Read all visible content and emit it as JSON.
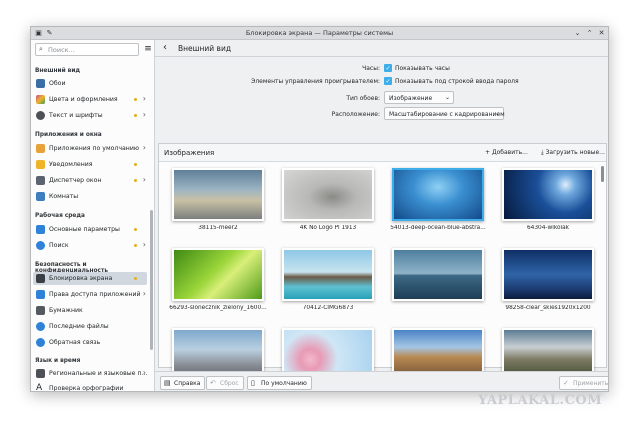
{
  "window": {
    "title": "Блокировка экрана — Параметры системы"
  },
  "sidebar": {
    "search_placeholder": "Поиск...",
    "sections": [
      {
        "title": "Внешний вид"
      },
      {
        "title": "Приложения и окна"
      },
      {
        "title": "Рабочая среда"
      },
      {
        "title": "Безопасность и конфиденциальность"
      },
      {
        "title": "Язык и время"
      }
    ],
    "items": [
      {
        "label": "Обои",
        "color": "#3a6ea5"
      },
      {
        "label": "Цвета и оформления",
        "color": "#c9508f"
      },
      {
        "label": "Текст и шрифты",
        "color": "#4d5157"
      },
      {
        "label": "Приложения по умолчанию",
        "color": "#e9a23b"
      },
      {
        "label": "Уведомления",
        "color": "#f0b429"
      },
      {
        "label": "Диспетчер окон",
        "color": "#5b6470"
      },
      {
        "label": "Комнаты",
        "color": "#3d7ebf"
      },
      {
        "label": "Основные параметры",
        "color": "#2f82d8"
      },
      {
        "label": "Поиск",
        "color": "#2f82d8"
      },
      {
        "label": "Блокировка экрана",
        "color": "#3a3f46"
      },
      {
        "label": "Права доступа приложений",
        "color": "#2f82d8"
      },
      {
        "label": "Бумажник",
        "color": "#555a60"
      },
      {
        "label": "Последние файлы",
        "color": "#2f82d8"
      },
      {
        "label": "Обратная связь",
        "color": "#2f82d8"
      },
      {
        "label": "Региональные и языковые п...",
        "color": "#4d5157"
      },
      {
        "label": "Проверка орфографии",
        "color": "#232629"
      }
    ]
  },
  "main": {
    "header": {
      "title": "Внешний вид"
    },
    "form": {
      "clock_label": "Часы:",
      "clock_value": "Показывать часы",
      "media_label": "Элементы управления проигрывателем:",
      "media_value": "Показывать под строкой ввода пароля",
      "type_label": "Тип обоев:",
      "type_value": "Изображение",
      "position_label": "Расположение:",
      "position_value": "Масштабирование с кадрированием"
    },
    "gallery": {
      "title": "Изображения",
      "add_label": "Добавить...",
      "download_label": "Загрузить новые...",
      "images": [
        {
          "label": "38115-meer2"
        },
        {
          "label": "4K No Logo Pl 1913"
        },
        {
          "label": "54013-deep-ocean-blue-abstra..."
        },
        {
          "label": "64304-wlkolak"
        },
        {
          "label": "66293-slonecznik_zielony_1600..."
        },
        {
          "label": "70412-CIMG6873"
        },
        {
          "label": ""
        },
        {
          "label": "98258-clear_skies1920x1200"
        },
        {
          "label": ""
        },
        {
          "label": ""
        },
        {
          "label": ""
        },
        {
          "label": ""
        }
      ]
    },
    "footer": {
      "help": "Справка",
      "reset": "Сброс",
      "defaults": "По умолчанию",
      "apply": "Применить"
    }
  },
  "watermark": "YAPLAKAL.COM"
}
